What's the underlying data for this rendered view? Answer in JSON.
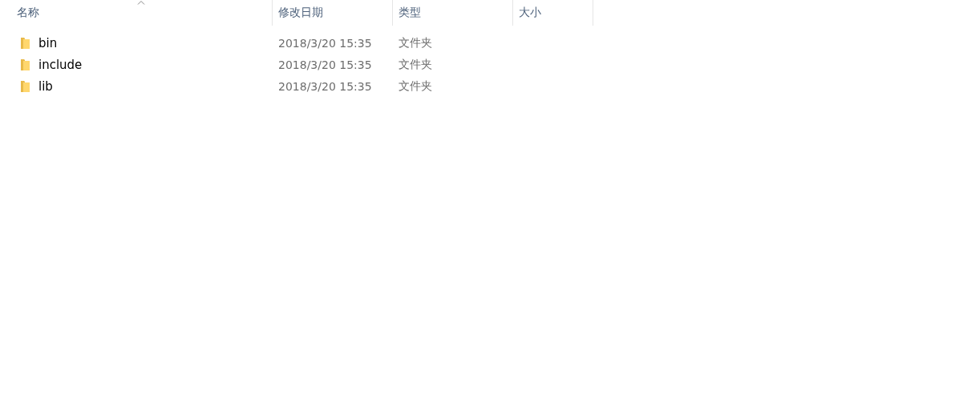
{
  "columns": [
    {
      "label": "名称",
      "sorted": true
    },
    {
      "label": "修改日期",
      "sorted": false
    },
    {
      "label": "类型",
      "sorted": false
    },
    {
      "label": "大小",
      "sorted": false
    }
  ],
  "rows": [
    {
      "name": "bin",
      "modified": "2018/3/20 15:35",
      "type": "文件夹"
    },
    {
      "name": "include",
      "modified": "2018/3/20 15:35",
      "type": "文件夹"
    },
    {
      "name": "lib",
      "modified": "2018/3/20 15:35",
      "type": "文件夹"
    }
  ]
}
